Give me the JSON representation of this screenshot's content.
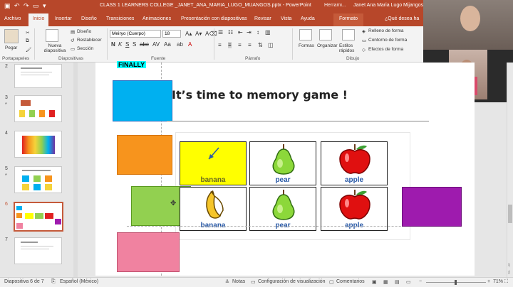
{
  "titlebar": {
    "title": "CLASS 1 LEARNERS COLLEGE _JANET_ANA_MARIA_LUGO_MUANGOS.pptx - PowerPoint",
    "herramientas": "Herrami...",
    "user": "Janet Ana Maria Lugo Mijangos"
  },
  "tabs": [
    "Archivo",
    "Inicio",
    "Insertar",
    "Diseño",
    "Transiciones",
    "Animaciones",
    "Presentación con diapositivas",
    "Revisar",
    "Vista",
    "Ayuda",
    "Formato",
    "¿Qué desea ha"
  ],
  "ribbon": {
    "pegar": "Pegar",
    "nueva": "Nueva diapositiva",
    "diseno": "Diseño",
    "restablecer": "Restablecer",
    "seccion": "Sección",
    "font_name": "Meiryo (Cuerpo)",
    "font_size": "18",
    "formas": "Formas",
    "organizar": "Organizar",
    "estilos": "Estilos rápidos",
    "relleno": "Relleno de forma",
    "contorno": "Contorno de forma",
    "efectos": "Efectos de forma",
    "groups": [
      "Portapapeles",
      "Diapositivas",
      "Fuente",
      "Párrafo",
      "Dibujo"
    ]
  },
  "thumbs": [
    "2",
    "3",
    "4",
    "5",
    "6",
    "7"
  ],
  "slide": {
    "finally": "FINALLY",
    "title": "It’s time to memory game !",
    "labels": [
      "banana",
      "pear",
      "apple",
      "banana",
      "pear",
      "apple"
    ]
  },
  "status": {
    "slide": "Diapositiva 6 de 7",
    "lang": "Español (México)",
    "notas": "Notas",
    "config": "Configuración de visualización",
    "comentarios": "Comentarios",
    "zoom": "71%"
  },
  "colors": {
    "accent": "#b7472a",
    "blue": "#00b0f0",
    "orange": "#f7941d",
    "green": "#92d050",
    "purple": "#9e1bae",
    "pink": "#f082a0",
    "yellow": "#ffff00"
  }
}
